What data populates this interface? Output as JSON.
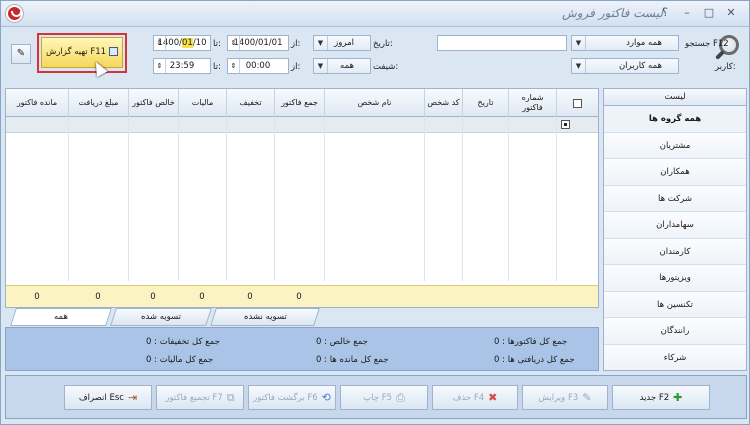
{
  "window": {
    "title": "لیست فاکتور فروش",
    "controls": [
      "؟",
      "–",
      "□",
      "✕"
    ]
  },
  "filters": {
    "search_label": "جستجو F12",
    "search_scope": "همه موارد",
    "search_value": "",
    "user_label": "کاربر:",
    "user_value": "همه کاربران",
    "date_label": "تاریخ:",
    "date_preset": "امروز",
    "shift_label": "شیفت:",
    "shift_value": "همه",
    "from_label": "از:",
    "to_label": "تا:",
    "date_from": "1400/01/01",
    "date_to_prefix": "1400/",
    "date_to_month": "01",
    "date_to_suffix": "/10",
    "time_from": "00:00",
    "time_to": "23:59"
  },
  "report_button": {
    "label": "تهیه گزارش F11"
  },
  "grid": {
    "columns": [
      "شماره فاکتور",
      "تاریخ",
      "کد شخص",
      "نام شخص",
      "جمع فاکتور",
      "تخفیف",
      "مالیات",
      "خالص فاکتور",
      "مبلغ دریافت",
      "مانده فاکتور"
    ],
    "footer_totals": [
      "0",
      "0",
      "0",
      "0",
      "0",
      "0"
    ]
  },
  "tabs": [
    "همه",
    "تسویه شده",
    "تسویه نشده"
  ],
  "summary": {
    "total_invoices": "جمع کل فاکتورها :",
    "total_net": "جمع خالص :",
    "total_discounts": "جمع کل تخفیفات :",
    "total_received": "جمع کل دریافتی ها :",
    "total_remaining": "جمع کل مانده ها :",
    "total_taxes": "جمع کل مالیات :",
    "values": [
      "0",
      "0",
      "0",
      "0",
      "0",
      "0"
    ]
  },
  "sidebar": {
    "header": "لیست",
    "items": [
      "همه گروه ها",
      "مشتریان",
      "همکاران",
      "شرکت ها",
      "سهامداران",
      "کارمندان",
      "ویزیتورها",
      "تکنسین ها",
      "رانندگان",
      "شرکاء"
    ]
  },
  "actions": {
    "new": "جدید F2",
    "edit": "ویرایش F3",
    "delete": "حذف F4",
    "print": "چاپ F5",
    "return": "برگشت فاکتور F6",
    "merge": "تجمیع فاکتور F7",
    "cancel": "انصراف Esc"
  }
}
